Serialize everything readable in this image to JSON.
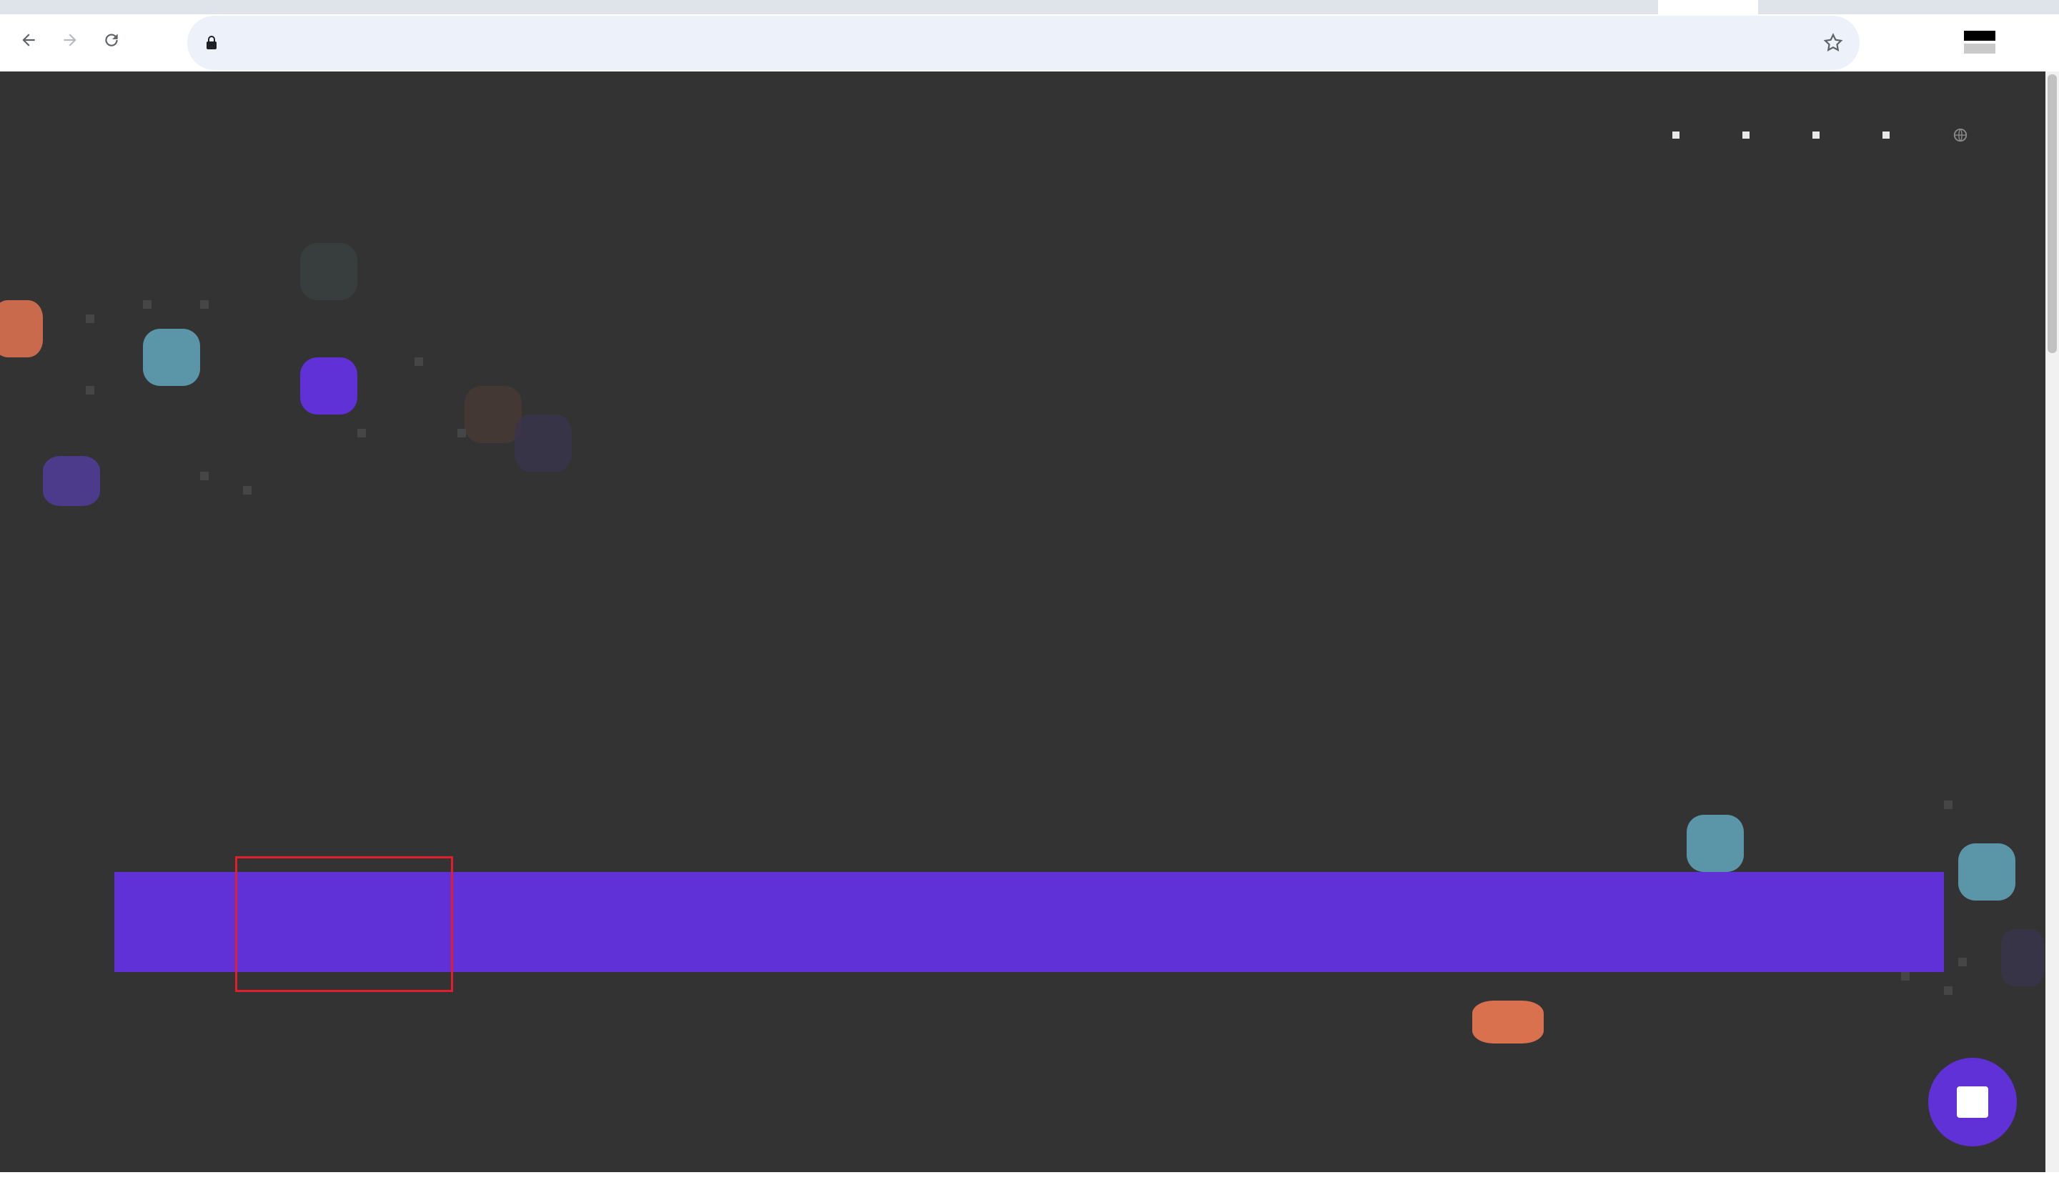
{
  "browser": {
    "url": "",
    "back_label": "←",
    "forward_label": "→",
    "reload_label": "⟳"
  },
  "site": {
    "logo": "",
    "nav": [
      {
        "label": ""
      },
      {
        "label": ""
      },
      {
        "label": ""
      },
      {
        "label": ""
      },
      {
        "label": ""
      },
      {
        "label": ""
      }
    ],
    "language_label": ""
  },
  "hero": {
    "text": "",
    "highlight": ""
  },
  "colors": {
    "background": "#333333",
    "accent": "#5f31d6",
    "teal": "#5b95a8",
    "coral": "#d9714f",
    "annotation": "#e11d2e"
  },
  "icons": {
    "back": "arrow-left-icon",
    "forward": "arrow-right-icon",
    "reload": "reload-icon",
    "lock": "lock-icon",
    "star": "star-icon",
    "menu": "menu-icon",
    "globe": "globe-icon",
    "chat": "chat-icon"
  }
}
